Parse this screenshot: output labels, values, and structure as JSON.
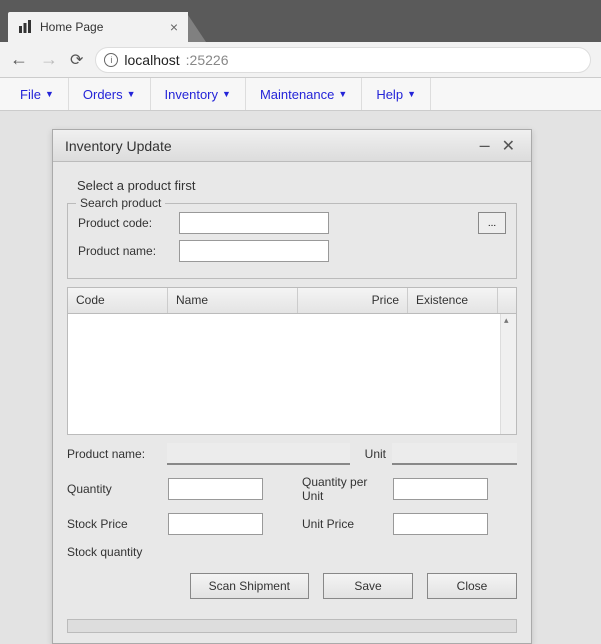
{
  "browser": {
    "tab_title": "Home Page",
    "url_host": "localhost",
    "url_port": ":25226"
  },
  "menu": {
    "items": [
      "File",
      "Orders",
      "Inventory",
      "Maintenance",
      "Help"
    ]
  },
  "dialog": {
    "title": "Inventory Update",
    "instruction": "Select a product first",
    "search": {
      "legend": "Search product",
      "code_label": "Product code:",
      "name_label": "Product name:",
      "code_value": "",
      "name_value": "",
      "lookup_label": "..."
    },
    "grid": {
      "code": "Code",
      "name": "Name",
      "price": "Price",
      "existence": "Existence"
    },
    "form": {
      "product_name_label": "Product name:",
      "product_name_value": "",
      "unit_label": "Unit",
      "unit_value": "",
      "quantity_label": "Quantity",
      "quantity_value": "",
      "qty_per_unit_label": "Quantity per Unit",
      "qty_per_unit_value": "",
      "stock_price_label": "Stock Price",
      "stock_price_value": "",
      "unit_price_label": "Unit Price",
      "unit_price_value": "",
      "stock_qty_label": "Stock quantity"
    },
    "buttons": {
      "scan": "Scan Shipment",
      "save": "Save",
      "close": "Close"
    }
  }
}
